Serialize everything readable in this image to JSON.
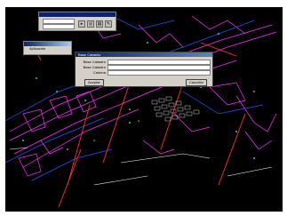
{
  "app_window": {
    "title": "",
    "label": "Aplicación"
  },
  "dialog": {
    "title": "Base Catastro",
    "fields": [
      {
        "label": "Base Catastro",
        "value": ""
      },
      {
        "label": "Base Catastro",
        "value": ""
      },
      {
        "label": "Cadena",
        "value": ""
      }
    ],
    "ok_label": "Aceptar",
    "cancel_label": "Cancelar"
  },
  "toolbar_window": {
    "icons": [
      "select-tool-icon",
      "zoom-tool-icon",
      "layer-tool-icon",
      "properties-tool-icon"
    ]
  },
  "colors": {
    "canvas_background": "#000000",
    "parcel_lines": "#ff33ff",
    "blue_lines": "#3050ff",
    "white_lines": "#ffffff",
    "red_lines": "#ff3030",
    "cyan_marks": "#30ffff",
    "dialog_title": "#0a246a"
  }
}
